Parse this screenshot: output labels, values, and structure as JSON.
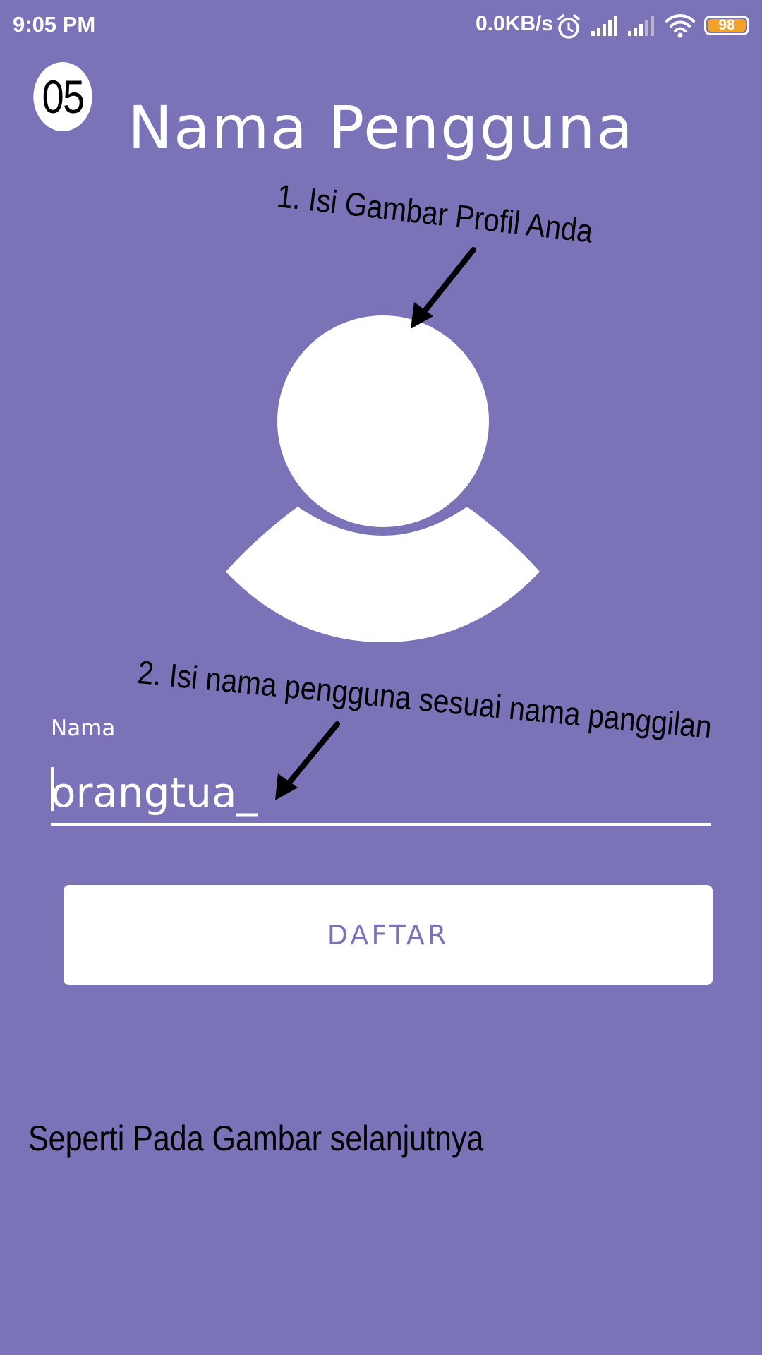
{
  "status_bar": {
    "time": "9:05 PM",
    "network_speed": "0.0KB/s",
    "battery_level": "98",
    "icons": [
      "alarm-icon",
      "signal-icon",
      "signal-icon",
      "wifi-icon",
      "battery-icon"
    ],
    "battery_color": "#f2a12a"
  },
  "step_number": "05",
  "title": "Nama Pengguna",
  "annotations": {
    "profile_hint": "1. Isi Gambar Profil Anda",
    "name_hint": "2. Isi nama pengguna sesuai nama panggilan",
    "footer_note": "Seperti Pada Gambar selanjutnya"
  },
  "avatar": {
    "icon": "user-avatar-icon"
  },
  "form": {
    "name_label": "Nama",
    "name_value": "orangtua_"
  },
  "register_button": {
    "label": "DAFTAR"
  },
  "colors": {
    "background": "#7a73b8",
    "foreground": "#ffffff",
    "annotation": "#000000"
  }
}
